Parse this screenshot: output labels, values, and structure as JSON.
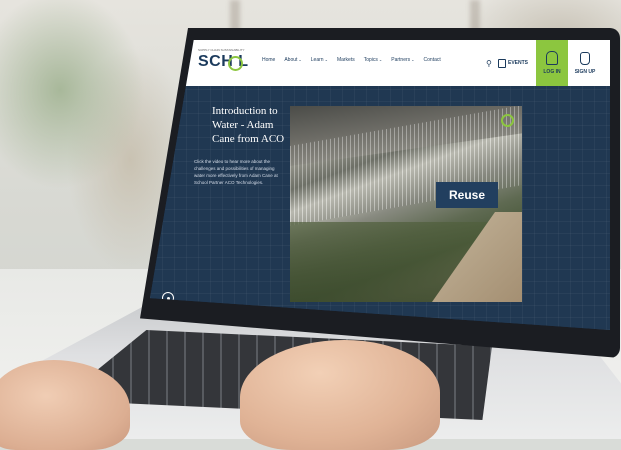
{
  "site": {
    "logo_small": "SUPPLY CHAIN SUSTAINABILITY",
    "logo_main": "SCH L"
  },
  "nav": {
    "items": [
      {
        "label": "Home",
        "has_caret": false
      },
      {
        "label": "About",
        "has_caret": true
      },
      {
        "label": "Learn",
        "has_caret": true
      },
      {
        "label": "Markets",
        "has_caret": false
      },
      {
        "label": "Topics",
        "has_caret": true
      },
      {
        "label": "Partners",
        "has_caret": true
      },
      {
        "label": "Contact",
        "has_caret": false
      }
    ],
    "events_label": "EVENTS",
    "login_label": "LOG IN",
    "signup_label": "SIGN UP"
  },
  "content": {
    "title": "Introduction to Water - Adam Cane from ACO",
    "description": "Click the video to hear more about the challenges and possibilities of managing water more effectively from Adam Cane at School Partner ACO Technologies.",
    "video_overlay": "Reuse"
  },
  "colors": {
    "brand_navy": "#1b3a5c",
    "brand_green": "#8cc63f",
    "page_bg": "#203852"
  },
  "icons": [
    "search-icon",
    "calendar-icon",
    "person-icon",
    "hand-icon",
    "play-icon"
  ]
}
